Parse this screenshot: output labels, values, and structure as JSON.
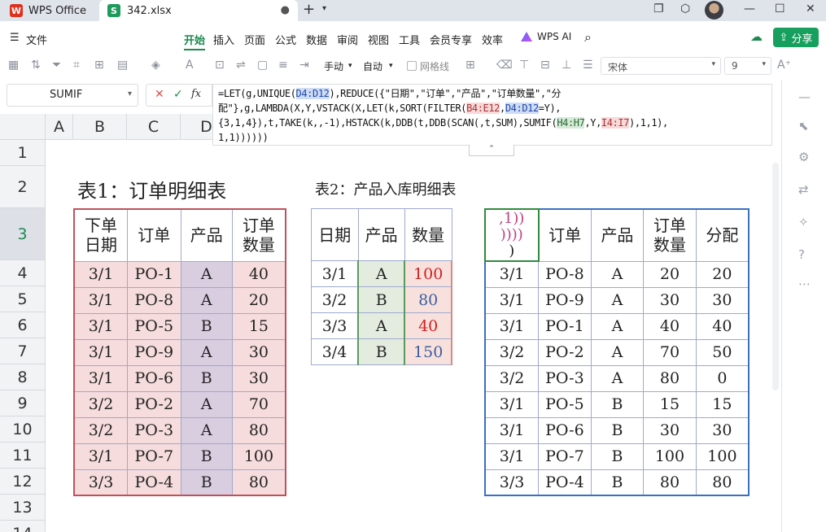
{
  "tabs": {
    "app_name": "WPS Office",
    "file_name": "342.xlsx",
    "new_tab_glyph": "+"
  },
  "menu": {
    "file_label": "文件",
    "items": [
      "开始",
      "插入",
      "页面",
      "公式",
      "数据",
      "审阅",
      "视图",
      "工具",
      "会员专享",
      "效率"
    ],
    "active": "开始",
    "ai_label": "WPS AI",
    "share_label": "分享"
  },
  "toolbar": {
    "wrap_label": "手动",
    "auto_label": "自动",
    "gridline_label": "网格线",
    "font_name": "宋体",
    "font_size": "9"
  },
  "formula_bar": {
    "name_box": "SUMIF",
    "fx_label": "fx",
    "line1_a": "=LET(g,UNIQUE(",
    "line1_ref1": "D4:D12",
    "line1_b": "),REDUCE({\"日期\",\"订单\",\"产品\",\"订单数量\",\"分",
    "line2_a": "配\"},g,LAMBDA(X,Y,VSTACK(X,LET(k,SORT(FILTER(",
    "line2_ref1": "B4:E12",
    "line2_sep": ",",
    "line2_ref2": "D4:D12",
    "line2_b": "=Y),",
    "line3": "{3,1,4}),t,TAKE(k,,-1),HSTACK(k,DDB(t,DDB(SCAN(,t,SUM),SUMIF(",
    "line3_ref1": "H4:H7",
    "line3_mid": ",Y,",
    "line3_ref2": "I4:I7",
    "line3_end": "),1,1),",
    "line4": "1,1))))))"
  },
  "columns": [
    "A",
    "B",
    "C",
    "D"
  ],
  "rows": [
    "1",
    "2",
    "3",
    "4",
    "5",
    "6",
    "7",
    "8",
    "9",
    "10",
    "11",
    "12",
    "13",
    "14"
  ],
  "table1": {
    "title": "表1：订单明细表",
    "headers": [
      "下单\n日期",
      "订单",
      "产品",
      "订单\n数量"
    ],
    "rows": [
      [
        "3/1",
        "PO-1",
        "A",
        "40"
      ],
      [
        "3/1",
        "PO-8",
        "A",
        "20"
      ],
      [
        "3/1",
        "PO-5",
        "B",
        "15"
      ],
      [
        "3/1",
        "PO-9",
        "A",
        "30"
      ],
      [
        "3/1",
        "PO-6",
        "B",
        "30"
      ],
      [
        "3/2",
        "PO-2",
        "A",
        "70"
      ],
      [
        "3/2",
        "PO-3",
        "A",
        "80"
      ],
      [
        "3/1",
        "PO-7",
        "B",
        "100"
      ],
      [
        "3/3",
        "PO-4",
        "B",
        "80"
      ]
    ]
  },
  "table2": {
    "title": "表2：产品入库明细表",
    "headers": [
      "日期",
      "产品",
      "数量"
    ],
    "rows": [
      [
        "3/1",
        "A",
        "100"
      ],
      [
        "3/2",
        "B",
        "80"
      ],
      [
        "3/3",
        "A",
        "40"
      ],
      [
        "3/4",
        "B",
        "150"
      ]
    ]
  },
  "table3": {
    "header0_line1": ",1))",
    "header0_line2": "))))",
    "header0_line3": ")",
    "headers": [
      "订单",
      "产品",
      "订单\n数量",
      "分配"
    ],
    "rows": [
      [
        "3/1",
        "PO-8",
        "A",
        "20",
        "20"
      ],
      [
        "3/1",
        "PO-9",
        "A",
        "30",
        "30"
      ],
      [
        "3/1",
        "PO-1",
        "A",
        "40",
        "40"
      ],
      [
        "3/2",
        "PO-2",
        "A",
        "70",
        "50"
      ],
      [
        "3/2",
        "PO-3",
        "A",
        "80",
        "0"
      ],
      [
        "3/1",
        "PO-5",
        "B",
        "15",
        "15"
      ],
      [
        "3/1",
        "PO-6",
        "B",
        "30",
        "30"
      ],
      [
        "3/1",
        "PO-7",
        "B",
        "100",
        "100"
      ],
      [
        "3/3",
        "PO-4",
        "B",
        "80",
        "80"
      ]
    ]
  },
  "colors": {
    "brand_green": "#1a8a4e",
    "share_green": "#17a05d",
    "ref_red": "#d21f1f",
    "ref_blue": "#3b5f9e"
  }
}
